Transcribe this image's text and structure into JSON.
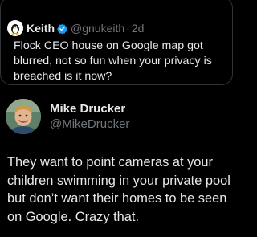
{
  "quoted_tweet": {
    "author_name": "Keith",
    "handle": "@gnukeith",
    "separator": "·",
    "time": "2d",
    "text": "Flock CEO house on Google map got blurred, not so fun when your privacy is breached is it now?",
    "avatar_icon": "tux-penguin-icon",
    "badge_icon": "verified-badge-icon",
    "badge_color": "#1d9bf0"
  },
  "tweet": {
    "author_name": "Mike Drucker",
    "handle": "@MikeDrucker",
    "text": "They want to point cameras at your children swimming in your private pool but don’t want their homes to be seen on Google. Crazy that.",
    "avatar_icon": "profile-photo"
  },
  "theme": {
    "background": "#000000",
    "text_primary": "#e7e9ea",
    "text_secondary": "#71767b",
    "border": "#2f3336"
  }
}
